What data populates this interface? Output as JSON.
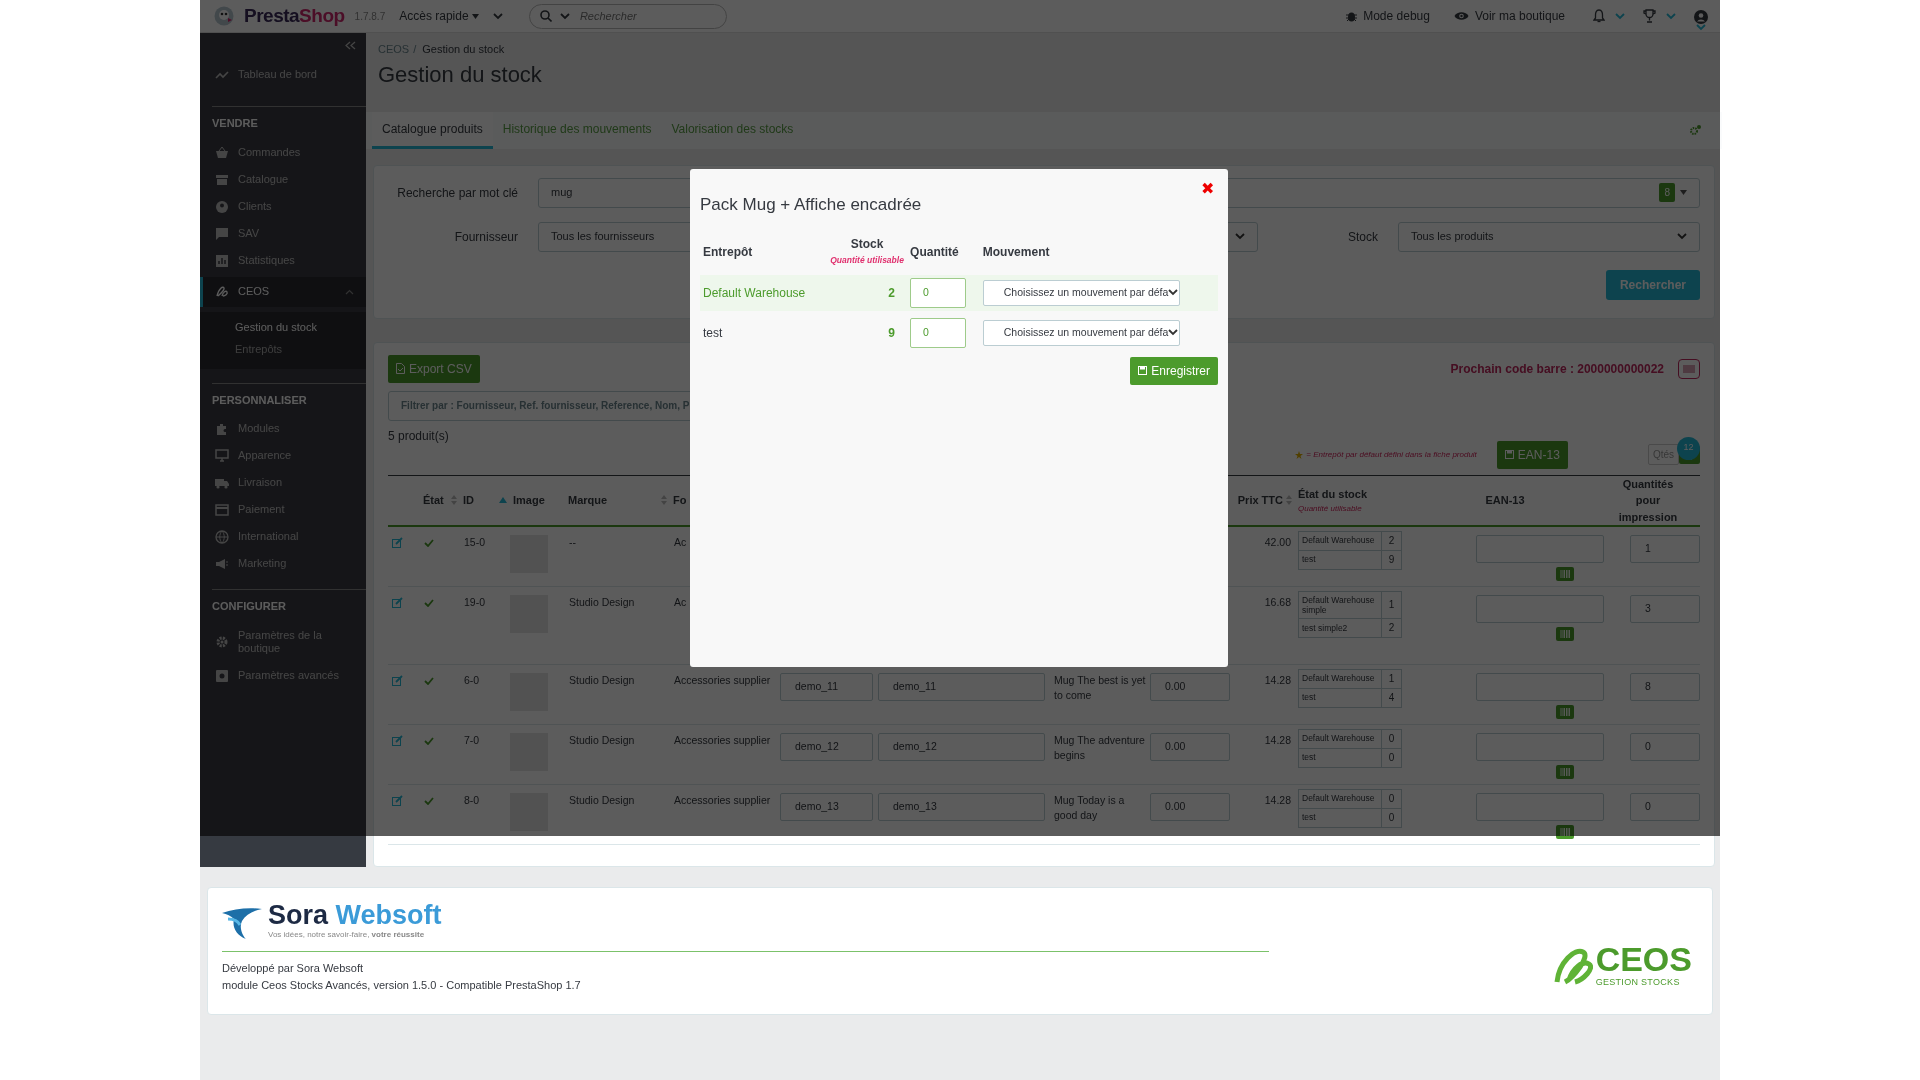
{
  "header": {
    "logo": {
      "first": "Presta",
      "second": "Shop"
    },
    "version": "1.7.8.7",
    "quick_access": "Accès rapide",
    "search_placeholder": "Rechercher",
    "debug": "Mode debug",
    "view_shop": "Voir ma boutique"
  },
  "sidebar": {
    "dashboard": "Tableau de bord",
    "sections": [
      {
        "title": "VENDRE",
        "items": [
          {
            "label": "Commandes",
            "selected": false
          },
          {
            "label": "Catalogue",
            "selected": false
          },
          {
            "label": "Clients",
            "selected": false
          },
          {
            "label": "SAV",
            "selected": false
          },
          {
            "label": "Statistiques",
            "selected": false
          },
          {
            "label": "CEOS",
            "selected": true,
            "expanded": true,
            "children": [
              {
                "label": "Gestion du stock",
                "selected": true
              },
              {
                "label": "Entrepôts",
                "selected": false
              }
            ]
          }
        ]
      },
      {
        "title": "PERSONNALISER",
        "items": [
          {
            "label": "Modules",
            "selected": false
          },
          {
            "label": "Apparence",
            "selected": false
          },
          {
            "label": "Livraison",
            "selected": false
          },
          {
            "label": "Paiement",
            "selected": false
          },
          {
            "label": "International",
            "selected": false
          },
          {
            "label": "Marketing",
            "selected": false
          }
        ]
      },
      {
        "title": "CONFIGURER",
        "items": [
          {
            "label": "Paramètres de la boutique",
            "selected": false
          },
          {
            "label": "Paramètres avancés",
            "selected": false
          }
        ]
      }
    ]
  },
  "breadcrumb": [
    "CEOS",
    "Gestion du stock"
  ],
  "breadcrumb_separator": "/",
  "title": "Gestion du stock",
  "tabs": [
    {
      "label": "Catalogue produits",
      "selected": true
    },
    {
      "label": "Historique des mouvements",
      "selected": false
    },
    {
      "label": "Valorisation des stocks",
      "selected": false
    }
  ],
  "filters": {
    "keyword_label": "Recherche par mot clé",
    "keyword_value": "mug",
    "keyword_count": "8",
    "supplier_label": "Fournisseur",
    "supplier_value": "Tous les fournisseurs",
    "stock_label": "Stock",
    "stock_value": "Tous les produits",
    "search_button": "Rechercher"
  },
  "products": {
    "export_button": "Export CSV",
    "next_barcode": "Prochain code barre : 2000000000022",
    "filter_placeholder": "Filtrer par : Fournisseur, Ref. fournisseur, Reference, Nom, P",
    "count": "5 produit(s)",
    "legend": "= Entrepôt par défaut défini dans la fiche produit",
    "ean_button": "EAN-13",
    "qty_button": "Qtés",
    "badge": "12",
    "columns": [
      {
        "label": "État",
        "sortable": true,
        "sorted": false
      },
      {
        "label": "ID",
        "sortable": true,
        "sorted": true
      },
      {
        "label": "Image"
      },
      {
        "label": "Marque",
        "sortable": true,
        "sorted": false
      },
      {
        "label": "Fo"
      },
      {
        "label": "Prix TTC",
        "sortable": true,
        "sorted": false
      },
      {
        "label": "État du stock",
        "sub": "Quantité utilisable"
      },
      {
        "label": "EAN-13"
      },
      {
        "label": "Quantités pour impression"
      }
    ],
    "rows": [
      {
        "active": true,
        "id": "15-0",
        "brand": "--",
        "supplier": "Ac",
        "price": "42.00",
        "stock": [
          {
            "warehouse": "Default Warehouse",
            "qty": "2"
          },
          {
            "warehouse": "test",
            "qty": "9"
          }
        ],
        "print_qty": "1"
      },
      {
        "active": true,
        "id": "19-0",
        "brand": "Studio Design",
        "supplier": "Ac",
        "price": "16.68",
        "stock": [
          {
            "warehouse": "Default Warehouse simple",
            "qty": "1"
          },
          {
            "warehouse": "test simple2",
            "qty": "2"
          }
        ],
        "print_qty": "3"
      },
      {
        "active": true,
        "id": "6-0",
        "brand": "Studio Design",
        "supplier": "Accessories supplier",
        "ref_1": "demo_11",
        "ref_2": "demo_11",
        "name": "Mug The best is yet to come",
        "cost": "0.00",
        "price": "14.28",
        "stock": [
          {
            "warehouse": "Default Warehouse",
            "qty": "1"
          },
          {
            "warehouse": "test",
            "qty": "4"
          }
        ],
        "print_qty": "8"
      },
      {
        "active": true,
        "id": "7-0",
        "brand": "Studio Design",
        "supplier": "Accessories supplier",
        "ref_1": "demo_12",
        "ref_2": "demo_12",
        "name": "Mug The adventure begins",
        "cost": "0.00",
        "price": "14.28",
        "stock": [
          {
            "warehouse": "Default Warehouse",
            "qty": "0"
          },
          {
            "warehouse": "test",
            "qty": "0"
          }
        ],
        "print_qty": "0"
      },
      {
        "active": true,
        "id": "8-0",
        "brand": "Studio Design",
        "supplier": "Accessories supplier",
        "ref_1": "demo_13",
        "ref_2": "demo_13",
        "name": "Mug Today is a good day",
        "cost": "0.00",
        "price": "14.28",
        "stock": [
          {
            "warehouse": "Default Warehouse",
            "qty": "0"
          },
          {
            "warehouse": "test",
            "qty": "0"
          }
        ],
        "print_qty": "0"
      }
    ]
  },
  "modal": {
    "title": "Pack Mug + Affiche encadrée",
    "close": "✖",
    "columns": {
      "warehouse": "Entrepôt",
      "stock": "Stock",
      "stock_sub": "Quantité utilisable",
      "quantity": "Quantité",
      "movement": "Mouvement"
    },
    "rows": [
      {
        "warehouse": "Default Warehouse",
        "default": true,
        "stock": "2",
        "quantity": "0",
        "movement": "Choisissez un mouvement par défa"
      },
      {
        "warehouse": "test",
        "default": false,
        "stock": "9",
        "quantity": "0",
        "movement": "Choisissez un mouvement par défa"
      }
    ],
    "save_button": "Enregistrer"
  },
  "footer": {
    "brand_first": "Sora",
    "brand_second": "Websoft",
    "tagline": "Vos idées, notre savoir-faire, **votre réussite**",
    "developer": "Développé par Sora Websoft",
    "module": "module Ceos Stocks Avancés, version 1.5.0 - Compatible PrestaShop 1.7",
    "ceos_logo": "CEOS",
    "ceos_sub": "GESTION STOCKS"
  }
}
